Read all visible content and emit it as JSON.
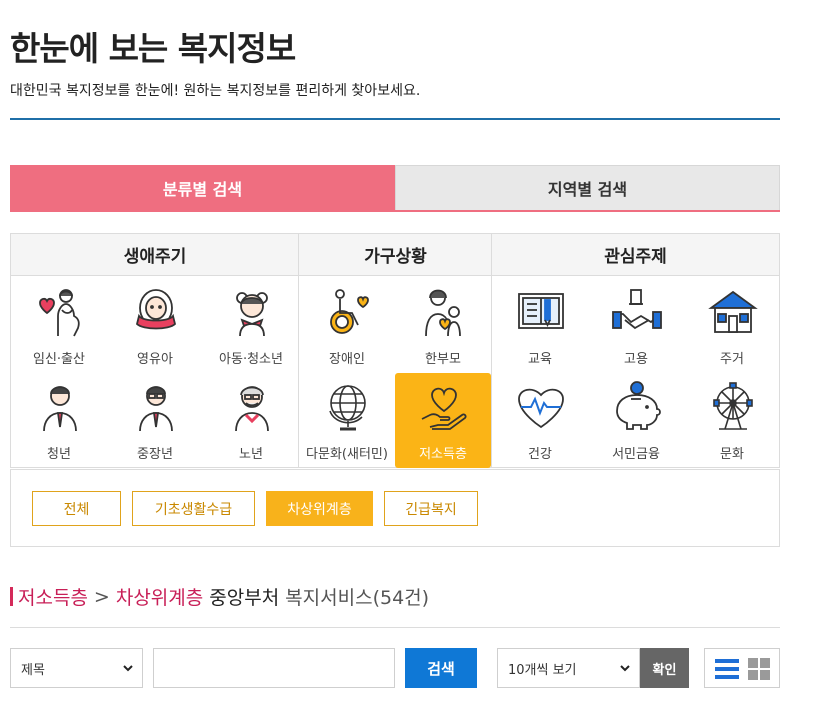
{
  "header": {
    "title": "한눈에 보는 복지정보",
    "description": "대한민국 복지정보를 한눈에! 원하는 복지정보를 편리하게 찾아보세요."
  },
  "tabs": [
    {
      "label": "분류별 검색",
      "active": true
    },
    {
      "label": "지역별 검색",
      "active": false
    }
  ],
  "categories": {
    "life_cycle": {
      "title": "생애주기",
      "items": [
        {
          "label": "임신·출산",
          "icon": "pregnancy-icon"
        },
        {
          "label": "영유아",
          "icon": "infant-icon"
        },
        {
          "label": "아동·청소년",
          "icon": "child-youth-icon"
        },
        {
          "label": "청년",
          "icon": "young-adult-icon"
        },
        {
          "label": "중장년",
          "icon": "middle-aged-icon"
        },
        {
          "label": "노년",
          "icon": "senior-icon"
        }
      ]
    },
    "household": {
      "title": "가구상황",
      "items": [
        {
          "label": "장애인",
          "icon": "wheelchair-icon"
        },
        {
          "label": "한부모",
          "icon": "single-parent-icon"
        },
        {
          "label": "다문화(새터민)",
          "icon": "globe-icon"
        },
        {
          "label": "저소득층",
          "icon": "heart-hand-icon",
          "active": true
        }
      ]
    },
    "interest": {
      "title": "관심주제",
      "items": [
        {
          "label": "교육",
          "icon": "book-icon"
        },
        {
          "label": "고용",
          "icon": "handshake-icon"
        },
        {
          "label": "주거",
          "icon": "house-icon"
        },
        {
          "label": "건강",
          "icon": "health-heart-icon"
        },
        {
          "label": "서민금융",
          "icon": "piggy-bank-icon"
        },
        {
          "label": "문화",
          "icon": "ferris-wheel-icon"
        }
      ]
    }
  },
  "filters": [
    {
      "label": "전체",
      "active": false
    },
    {
      "label": "기초생활수급",
      "active": false
    },
    {
      "label": "차상위계층",
      "active": true
    },
    {
      "label": "긴급복지",
      "active": false
    }
  ],
  "result": {
    "category": "저소득층",
    "separator": ">",
    "subcategory": "차상위계층",
    "department": "중앙부처",
    "label": "복지서비스(54건)"
  },
  "search": {
    "field_select": "제목",
    "query_value": "",
    "search_button": "검색",
    "page_size_select": "10개씩 보기",
    "confirm_button": "확인"
  },
  "colors": {
    "active_tab": "#ef6e80",
    "active_item": "#fbb416",
    "search_blue": "#0f78d6",
    "title_rule": "#1f6fa8",
    "result_pink": "#c81f57"
  }
}
